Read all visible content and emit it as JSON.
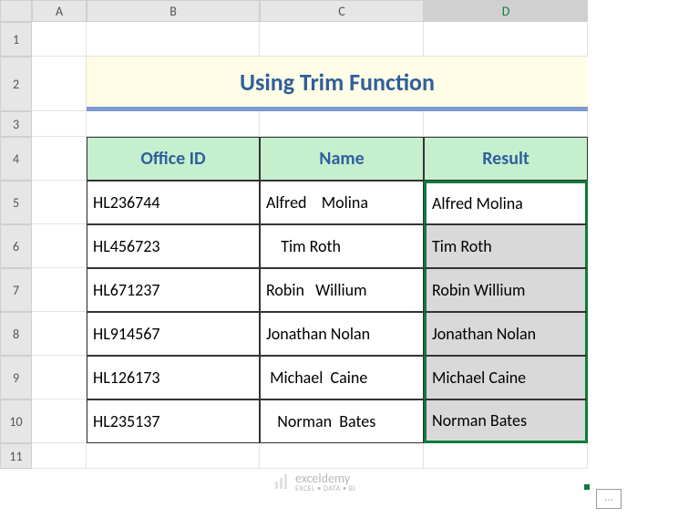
{
  "columns": [
    "A",
    "B",
    "C",
    "D"
  ],
  "rows": [
    "1",
    "2",
    "3",
    "4",
    "5",
    "6",
    "7",
    "8",
    "9",
    "10",
    "11"
  ],
  "active_column_index": 3,
  "title": "Using Trim Function",
  "headers": {
    "b": "Office ID",
    "c": "Name",
    "d": "Result"
  },
  "data": [
    {
      "id": "HL236744",
      "name": "Alfred    Molina",
      "result": "Alfred Molina",
      "shaded": false
    },
    {
      "id": "HL456723",
      "name": "    Tim Roth",
      "result": "Tim Roth",
      "shaded": true
    },
    {
      "id": "HL671237",
      "name": "Robin   Willium",
      "result": "Robin Willium",
      "shaded": true
    },
    {
      "id": "HL914567",
      "name": "Jonathan Nolan",
      "result": "Jonathan Nolan",
      "shaded": true
    },
    {
      "id": "HL126173",
      "name": " Michael  Caine",
      "result": "Michael Caine",
      "shaded": true
    },
    {
      "id": "HL235137",
      "name": "   Norman  Bates",
      "result": "Norman Bates",
      "shaded": true
    }
  ],
  "watermark": {
    "brand": "exceldemy",
    "tagline": "EXCEL • DATA • BI"
  },
  "icons": {
    "autofill": "⋯"
  },
  "chart_data": {
    "type": "table",
    "title": "Using Trim Function",
    "columns": [
      "Office ID",
      "Name",
      "Result"
    ],
    "rows": [
      [
        "HL236744",
        "Alfred    Molina",
        "Alfred Molina"
      ],
      [
        "HL456723",
        "    Tim Roth",
        "Tim Roth"
      ],
      [
        "HL671237",
        "Robin   Willium",
        "Robin Willium"
      ],
      [
        "HL914567",
        "Jonathan Nolan",
        "Jonathan Nolan"
      ],
      [
        "HL126173",
        " Michael  Caine",
        "Michael Caine"
      ],
      [
        "HL235137",
        "   Norman  Bates",
        "Norman Bates"
      ]
    ]
  }
}
